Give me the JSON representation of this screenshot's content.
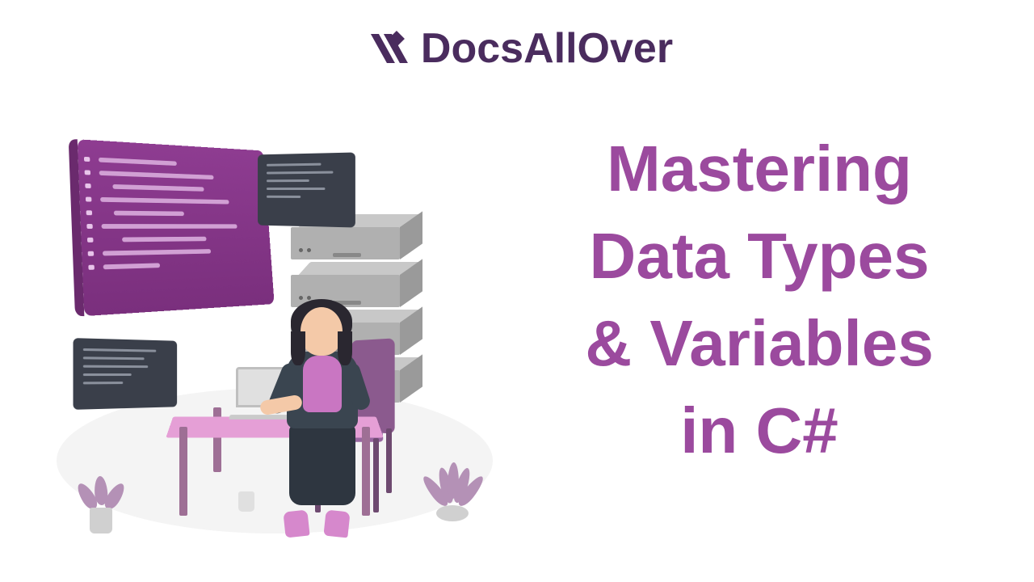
{
  "header": {
    "brand": "DocsAllOver",
    "logo_icon_name": "docsallover-logo"
  },
  "title": {
    "line1": "Mastering",
    "line2": "Data Types",
    "line3": "& Variables",
    "line4": "in C#"
  },
  "colors": {
    "brand_dark": "#4a2c5e",
    "title_purple": "#9b4a9e",
    "accent_magenta": "#8e3c91",
    "desk_pink": "#e59fd6"
  }
}
